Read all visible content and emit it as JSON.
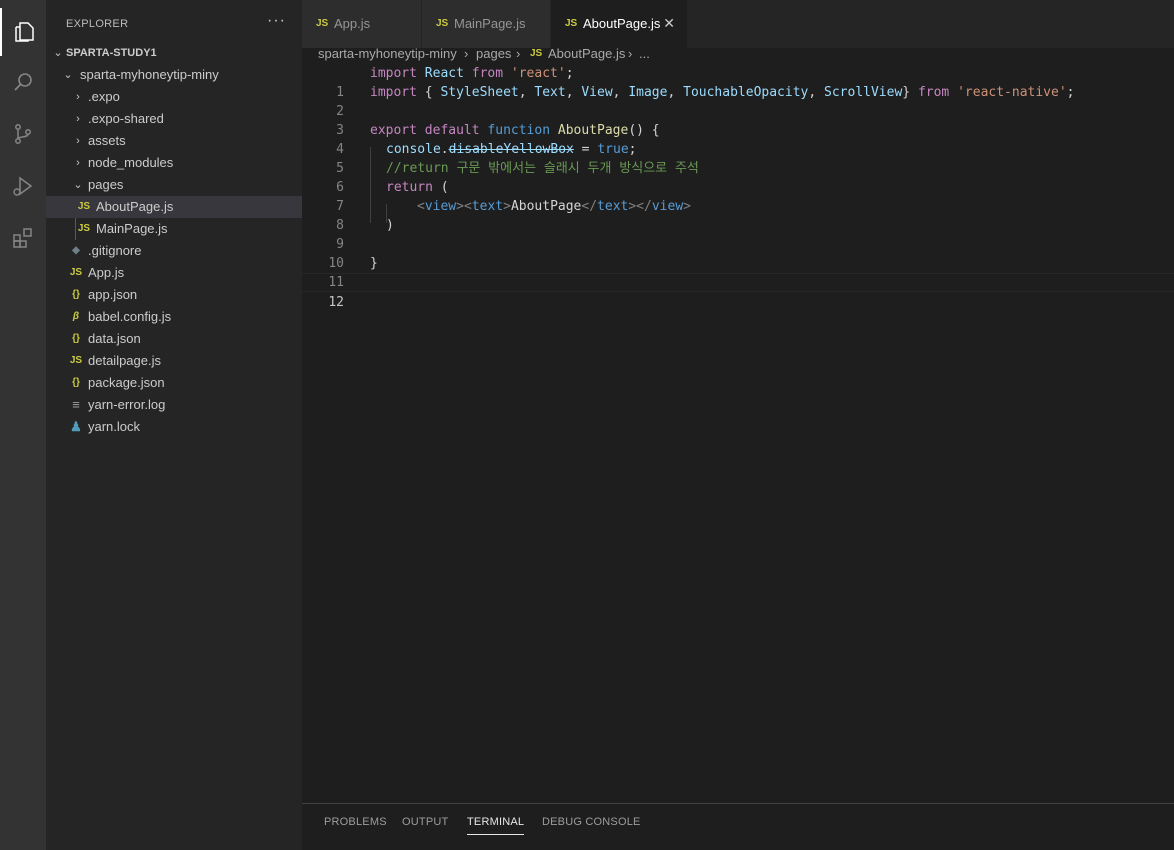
{
  "explorer": {
    "title": "EXPLORER",
    "more": "···",
    "root": "SPARTA-STUDY1",
    "items": [
      {
        "label": "sparta-myhoneytip-miny",
        "chev": "⌄",
        "icon": ""
      },
      {
        "label": ".expo",
        "chev": "›",
        "icon": ""
      },
      {
        "label": ".expo-shared",
        "chev": "›",
        "icon": ""
      },
      {
        "label": "assets",
        "chev": "›",
        "icon": ""
      },
      {
        "label": "node_modules",
        "chev": "›",
        "icon": ""
      },
      {
        "label": "pages",
        "chev": "⌄",
        "icon": ""
      },
      {
        "label": "AboutPage.js",
        "chev": "",
        "icon": "JS"
      },
      {
        "label": "MainPage.js",
        "chev": "",
        "icon": "JS"
      },
      {
        "label": ".gitignore",
        "chev": "",
        "icon": "◆"
      },
      {
        "label": "App.js",
        "chev": "",
        "icon": "JS"
      },
      {
        "label": "app.json",
        "chev": "",
        "icon": "{}"
      },
      {
        "label": "babel.config.js",
        "chev": "",
        "icon": "β"
      },
      {
        "label": "data.json",
        "chev": "",
        "icon": "{}"
      },
      {
        "label": "detailpage.js",
        "chev": "",
        "icon": "JS"
      },
      {
        "label": "package.json",
        "chev": "",
        "icon": "{}"
      },
      {
        "label": "yarn-error.log",
        "chev": "",
        "icon": "≡"
      },
      {
        "label": "yarn.lock",
        "chev": "",
        "icon": "♟"
      }
    ]
  },
  "tabs": [
    {
      "label": "App.js",
      "icon": "JS"
    },
    {
      "label": "MainPage.js",
      "icon": "JS"
    },
    {
      "label": "AboutPage.js",
      "icon": "JS",
      "close": "✕"
    }
  ],
  "breadcrumb": {
    "folder": "sparta-myhoneytip-miny",
    "sep1": "›",
    "sub": "pages",
    "sep2": "›",
    "icon": "JS",
    "file": "AboutPage.js",
    "sep3": "›",
    "tail": "..."
  },
  "code": {
    "line_numbers": [
      "1",
      "2",
      "3",
      "4",
      "5",
      "6",
      "7",
      "8",
      "9",
      "10",
      "11",
      "12"
    ],
    "l1": {
      "a": "import",
      "b": " React ",
      "c": "from",
      "d": " 'react'",
      "e": ";"
    },
    "l2": {
      "a": "import",
      "b": " { ",
      "c": "StyleSheet",
      "d": ", ",
      "e": "Text",
      "f": ", ",
      "g": "View",
      "h": ", ",
      "i": "Image",
      "j": ", ",
      "k": "TouchableOpacity",
      "l": ", ",
      "m": "ScrollView",
      "n": "} ",
      "o": "from",
      "p": " 'react-native'",
      "q": ";"
    },
    "l4": {
      "a": "export",
      "b": " default ",
      "c": "function",
      "d": " AboutPage",
      "e": "() {"
    },
    "l5": {
      "a": "console",
      "b": ".",
      "c": "disableYellowBox",
      "d": " = ",
      "e": "true",
      "f": ";"
    },
    "l6": {
      "a": "//return 구문 밖에서는 슬래시 두개 방식으로 주석"
    },
    "l7": {
      "a": "return",
      "b": " ("
    },
    "l8": {
      "a": "<",
      "b": "view",
      "c": "><",
      "d": "text",
      "e": ">",
      "f": "AboutPage",
      "g": "</",
      "h": "text",
      "i": "></",
      "j": "view",
      "k": ">"
    },
    "l9": {
      "a": ")"
    },
    "l11": {
      "a": "}"
    }
  },
  "panel": {
    "tabs": [
      "PROBLEMS",
      "OUTPUT",
      "TERMINAL",
      "DEBUG CONSOLE"
    ]
  }
}
